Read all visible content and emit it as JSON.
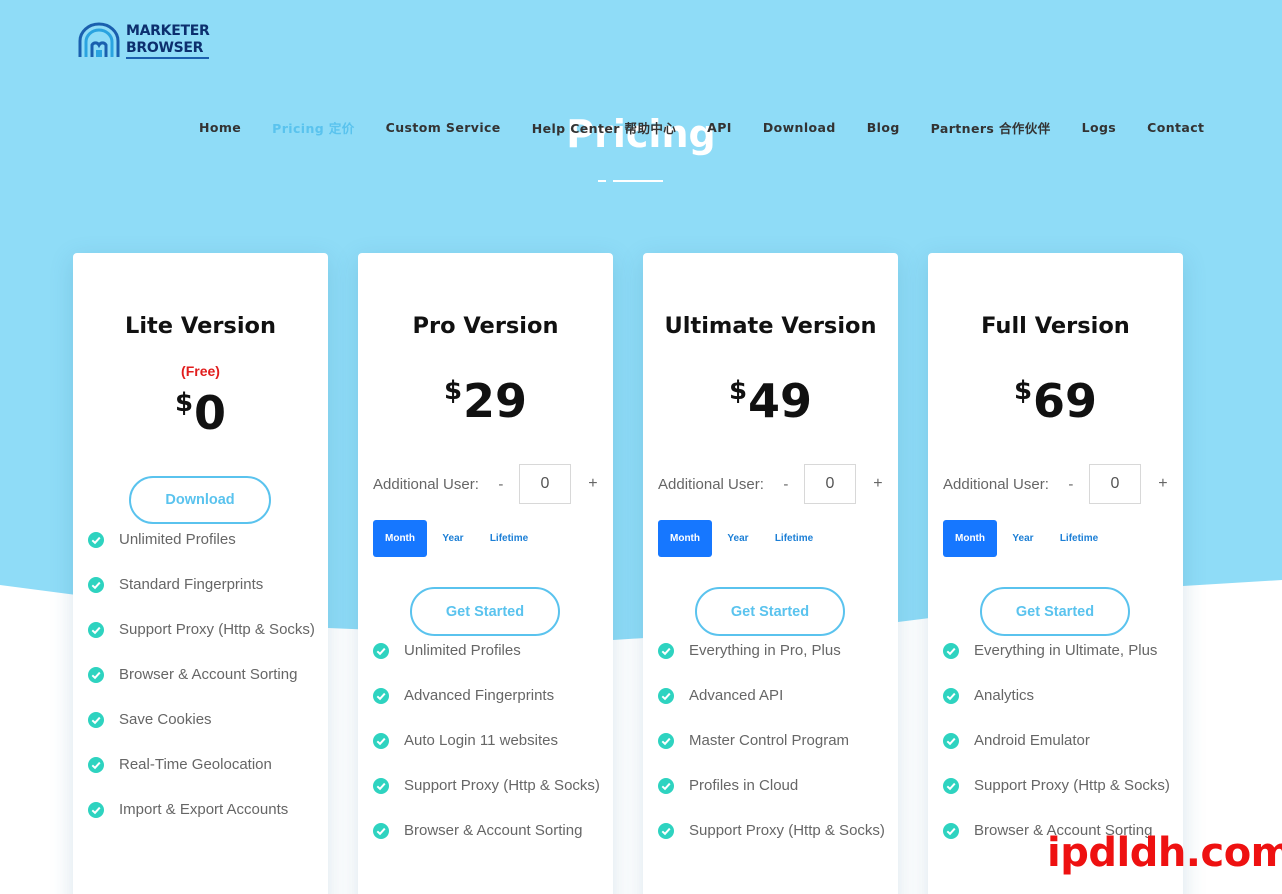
{
  "logo": {
    "line1": "MARKETER",
    "line2": "BROWSER"
  },
  "nav": {
    "items": [
      {
        "id": "home",
        "label": "Home",
        "active": false
      },
      {
        "id": "pricing",
        "label": "Pricing  定价",
        "active": true
      },
      {
        "id": "custom-service",
        "label": "Custom Service",
        "active": false
      },
      {
        "id": "help-center",
        "label": "Help Center  帮助中心",
        "active": false
      },
      {
        "id": "api",
        "label": "API",
        "active": false
      },
      {
        "id": "download",
        "label": "Download",
        "active": false
      },
      {
        "id": "blog",
        "label": "Blog",
        "active": false
      },
      {
        "id": "partners",
        "label": "Partners  合作伙伴",
        "active": false
      },
      {
        "id": "logs",
        "label": "Logs",
        "active": false
      },
      {
        "id": "contact",
        "label": "Contact",
        "active": false
      }
    ]
  },
  "hero": {
    "title": "Pricing"
  },
  "colors": {
    "accent": "#5ac3ee",
    "hero_bg": "#8fdcf7",
    "primary_btn": "#1677ff",
    "check": "#2ed3c0",
    "free_red": "#e11d1d"
  },
  "plans": [
    {
      "title": "Lite Version",
      "note": "(Free)",
      "currency": "$",
      "price": "0",
      "cta": "Download",
      "features": [
        "Unlimited Profiles",
        "Standard Fingerprints",
        "Support Proxy (Http & Socks)",
        "Browser & Account Sorting",
        "Save Cookies",
        "Real-Time Geolocation",
        "Import & Export Accounts"
      ]
    },
    {
      "title": "Pro Version",
      "currency": "$",
      "price": "29",
      "additional_label": "Additional User:",
      "minus": "-",
      "qty": "0",
      "plus": "+",
      "periods": [
        "Month",
        "Year",
        "Lifetime"
      ],
      "cta": "Get Started",
      "features": [
        "Unlimited Profiles",
        "Advanced Fingerprints",
        "Auto Login 11 websites",
        "Support Proxy (Http & Socks)",
        "Browser & Account Sorting"
      ]
    },
    {
      "title": "Ultimate Version",
      "currency": "$",
      "price": "49",
      "additional_label": "Additional User:",
      "minus": "-",
      "qty": "0",
      "plus": "+",
      "periods": [
        "Month",
        "Year",
        "Lifetime"
      ],
      "cta": "Get Started",
      "features": [
        "Everything in Pro, Plus",
        "Advanced API",
        "Master Control Program",
        "Profiles in Cloud",
        "Support Proxy (Http & Socks)"
      ]
    },
    {
      "title": "Full Version",
      "currency": "$",
      "price": "69",
      "additional_label": "Additional User:",
      "minus": "-",
      "qty": "0",
      "plus": "+",
      "periods": [
        "Month",
        "Year",
        "Lifetime"
      ],
      "cta": "Get Started",
      "features": [
        "Everything in Ultimate, Plus",
        "Analytics",
        "Android Emulator",
        "Support Proxy (Http & Socks)",
        "Browser & Account Sorting"
      ]
    }
  ],
  "watermark": "ipdldh.com"
}
